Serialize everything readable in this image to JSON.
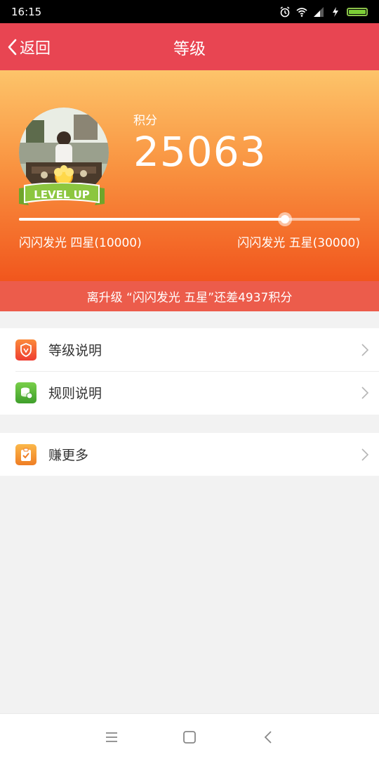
{
  "status_bar": {
    "time": "16:15"
  },
  "header": {
    "back_label": "返回",
    "title": "等级"
  },
  "profile": {
    "badge_text": "LEVEL UP",
    "score_label": "积分",
    "score": "25063",
    "progress_fraction": 0.78,
    "current_level": "闪闪发光 四星(10000)",
    "next_level": "闪闪发光 五星(30000)"
  },
  "banner_text": "离升级 “闪闪发光 五星”还差4937积分",
  "menu": {
    "group1": [
      {
        "label": "等级说明",
        "icon": "shield-icon",
        "color": "#f0553a"
      },
      {
        "label": "规则说明",
        "icon": "coins-icon",
        "color": "#59b83a"
      }
    ],
    "group2": [
      {
        "label": "赚更多",
        "icon": "clipboard-check-icon",
        "color": "#f29b2a"
      }
    ]
  }
}
